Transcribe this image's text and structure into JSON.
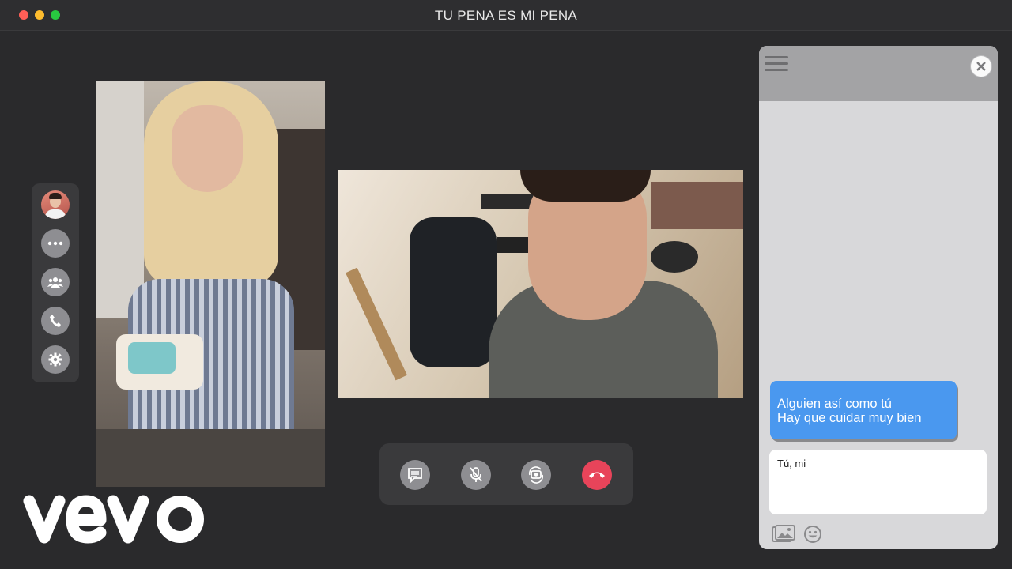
{
  "window": {
    "title": "TU PENA ES MI PENA"
  },
  "sidenav": {
    "items": [
      {
        "name": "profile",
        "icon": "avatar"
      },
      {
        "name": "more",
        "icon": "more-dots-icon"
      },
      {
        "name": "contacts",
        "icon": "group-icon"
      },
      {
        "name": "call",
        "icon": "phone-icon"
      },
      {
        "name": "settings",
        "icon": "gear-icon"
      }
    ]
  },
  "call_controls": [
    {
      "name": "chat",
      "icon": "message-icon"
    },
    {
      "name": "mute",
      "icon": "mic-off-icon"
    },
    {
      "name": "switch-camera",
      "icon": "camera-rotate-icon"
    },
    {
      "name": "end-call",
      "icon": "hang-up-icon",
      "color": "#e8445a"
    }
  ],
  "chat": {
    "message": {
      "line1": "Alguien así como tú",
      "line2": "Hay que cuidar muy bien"
    },
    "compose_value": "Tú, mi",
    "tools": [
      "image-icon",
      "emoji-icon"
    ],
    "bubble_color": "#4a98ef"
  },
  "watermark": {
    "brand": "vevo"
  }
}
